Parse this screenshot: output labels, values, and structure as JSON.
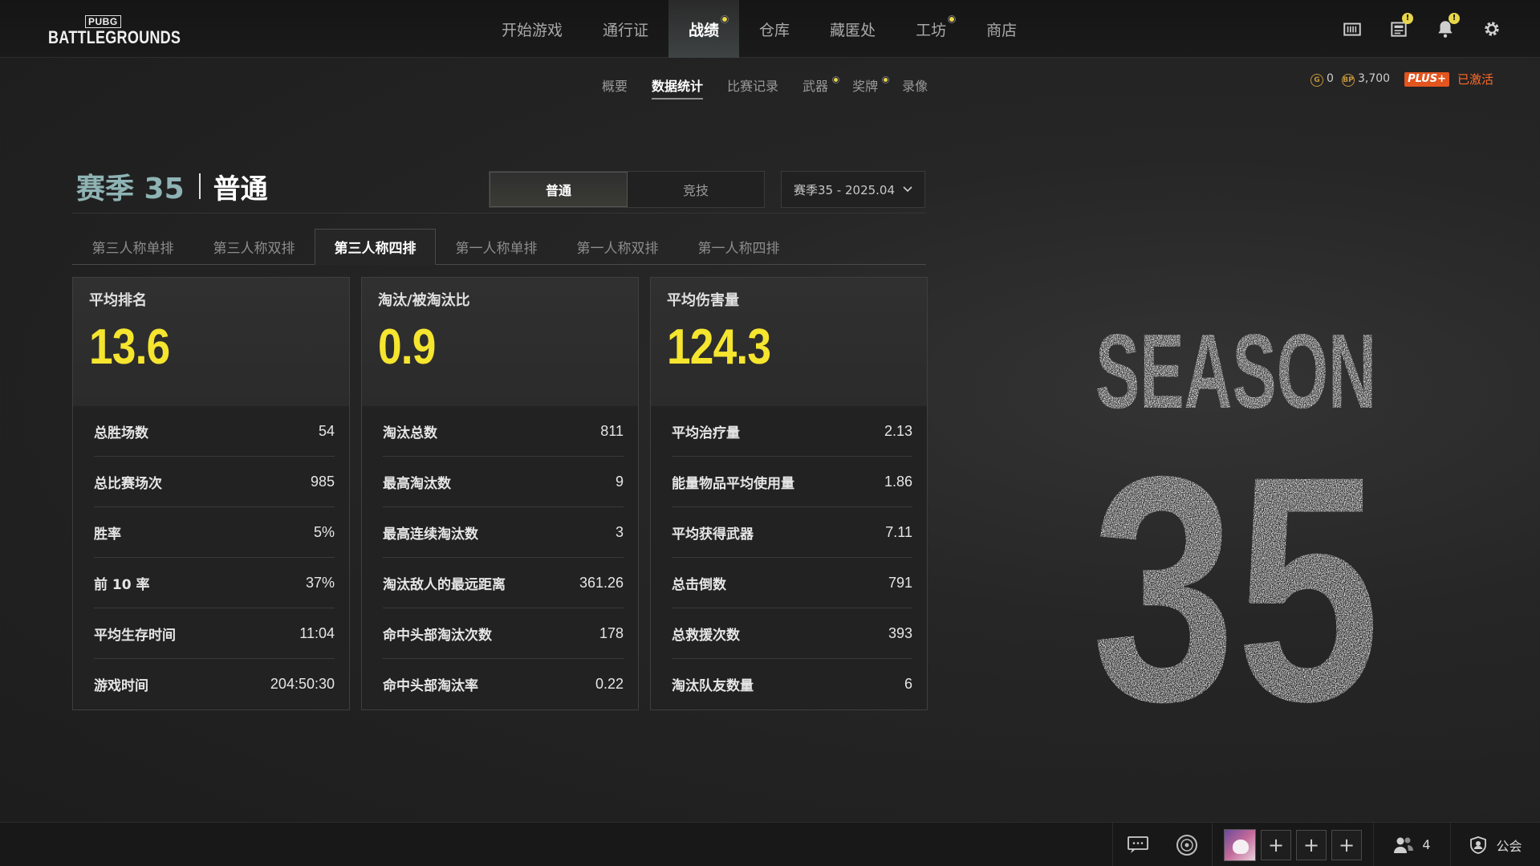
{
  "logo": {
    "small": "PUBG",
    "main": "BATTLEGROUNDS"
  },
  "mainnav": [
    {
      "label": "开始游戏",
      "active": false,
      "dot": false
    },
    {
      "label": "通行证",
      "active": false,
      "dot": false
    },
    {
      "label": "战绩",
      "active": true,
      "dot": true
    },
    {
      "label": "仓库",
      "active": false,
      "dot": false
    },
    {
      "label": "藏匿处",
      "active": false,
      "dot": false
    },
    {
      "label": "工坊",
      "active": false,
      "dot": true
    },
    {
      "label": "商店",
      "active": false,
      "dot": false
    }
  ],
  "topicons": [
    "storage-icon",
    "news-icon",
    "notification-bell-icon",
    "settings-gear-icon"
  ],
  "subnav": [
    {
      "label": "概要",
      "active": false,
      "dot": false
    },
    {
      "label": "数据统计",
      "active": true,
      "dot": false
    },
    {
      "label": "比赛记录",
      "active": false,
      "dot": false
    },
    {
      "label": "武器",
      "active": false,
      "dot": true
    },
    {
      "label": "奖牌",
      "active": false,
      "dot": true
    },
    {
      "label": "录像",
      "active": false,
      "dot": false
    }
  ],
  "currency": {
    "g_coin_symbol": "G",
    "g_coin": "0",
    "bp_symbol": "BP",
    "bp": "3,700",
    "plus_label": "PLUS+",
    "plus_status": "已激活"
  },
  "season": {
    "name": "赛季 35",
    "mode": "普通"
  },
  "mode_toggle": {
    "options": [
      "普通",
      "竞技"
    ],
    "selected": "普通"
  },
  "season_select": {
    "value": "赛季35 - 2025.04"
  },
  "perspective_tabs": [
    {
      "label": "第三人称单排",
      "active": false
    },
    {
      "label": "第三人称双排",
      "active": false
    },
    {
      "label": "第三人称四排",
      "active": true
    },
    {
      "label": "第一人称单排",
      "active": false
    },
    {
      "label": "第一人称双排",
      "active": false
    },
    {
      "label": "第一人称四排",
      "active": false
    }
  ],
  "cards": [
    {
      "label": "平均排名",
      "value": "13.6",
      "rows": [
        {
          "k": "总胜场数",
          "v": "54"
        },
        {
          "k": "总比赛场次",
          "v": "985"
        },
        {
          "k": "胜率",
          "v": "5%"
        },
        {
          "k": "前 10 率",
          "v": "37%"
        },
        {
          "k": "平均生存时间",
          "v": "11:04"
        },
        {
          "k": "游戏时间",
          "v": "204:50:30"
        }
      ]
    },
    {
      "label": "淘汰/被淘汰比",
      "value": "0.9",
      "rows": [
        {
          "k": "淘汰总数",
          "v": "811"
        },
        {
          "k": "最高淘汰数",
          "v": "9"
        },
        {
          "k": "最高连续淘汰数",
          "v": "3"
        },
        {
          "k": "淘汰敌人的最远距离",
          "v": "361.26"
        },
        {
          "k": "命中头部淘汰次数",
          "v": "178"
        },
        {
          "k": "命中头部淘汰率",
          "v": "0.22"
        }
      ]
    },
    {
      "label": "平均伤害量",
      "value": "124.3",
      "rows": [
        {
          "k": "平均治疗量",
          "v": "2.13"
        },
        {
          "k": "能量物品平均使用量",
          "v": "1.86"
        },
        {
          "k": "平均获得武器",
          "v": "7.11"
        },
        {
          "k": "总击倒数",
          "v": "791"
        },
        {
          "k": "总救援次数",
          "v": "393"
        },
        {
          "k": "淘汰队友数量",
          "v": "6"
        }
      ]
    }
  ],
  "season_art": {
    "word": "SEASON",
    "number": "35"
  },
  "bottombar": {
    "friends_count": "4",
    "clan_label": "公会",
    "empty_slot": "+"
  },
  "colors": {
    "accent_yellow": "#f5e52f",
    "season_teal": "#8fb3b4",
    "plus_orange": "#e2551f"
  }
}
